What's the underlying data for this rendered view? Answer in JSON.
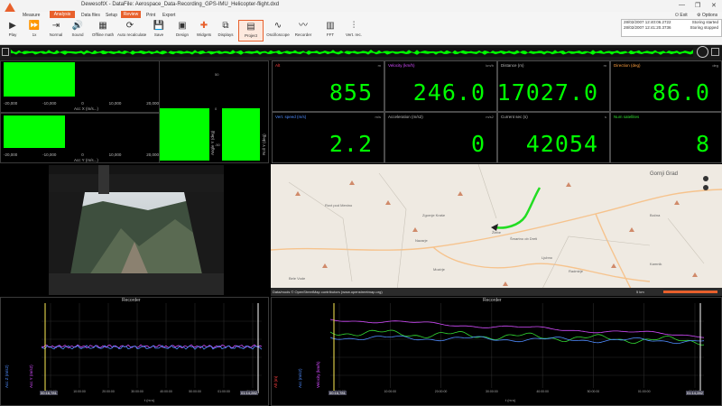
{
  "app": {
    "title": "DewesoftX - DataFile: Aerospace_Data-Recording_GPS-IMU_Helicopter-flight.dxd",
    "minimize": "—",
    "maximize": "❐",
    "close": "✕",
    "exit": "Exit",
    "options": "Options"
  },
  "menu": {
    "measure": "Measure",
    "analysis": "Analysis",
    "data_files": "Data files",
    "setup": "Setup",
    "review": "Review",
    "print": "Print",
    "export": "Export"
  },
  "toolbar": {
    "play": "Play",
    "step": "1x",
    "normal": "Normal",
    "sound": "Sound",
    "offline_math": "Offline math",
    "auto_recalculate": "Auto recalculate",
    "save": "Save",
    "design": "Design",
    "widgets": "Widgets",
    "displays": "Displays",
    "project": "Project",
    "oscilloscope": "Oscilloscope",
    "recorder": "Recorder",
    "fft": "FFT",
    "vert_rec": "Vert. rec."
  },
  "log": [
    {
      "time": "28/02/2007 12:40:06.2722",
      "msg": "Storing started"
    },
    {
      "time": "28/02/2007 12:41:20.3736",
      "msg": "Storing stopped"
    }
  ],
  "histograms": {
    "top": {
      "ticks": [
        "-20,000",
        "-10,000",
        "0",
        "10,000",
        "20,000"
      ],
      "axis": "Acc X (m/s...)",
      "value": 0.44
    },
    "bottom": {
      "ticks": [
        "-20,000",
        "-10,000",
        "0",
        "10,000",
        "20,000"
      ],
      "axis": "Acc Y (m/s...)",
      "value": 0.38
    }
  },
  "vbars": {
    "left_label": "Angle Y (deg)",
    "right_label": "Roll Y (deg)",
    "ticks_left": [
      "300",
      "50",
      "0",
      "-50"
    ],
    "ticks_right": [
      "300",
      "50",
      "0",
      "-50"
    ]
  },
  "digitals": [
    {
      "title": "Alt",
      "unit": "m",
      "value": "855",
      "color": "#ff4040"
    },
    {
      "title": "Velocity (km/h)",
      "unit": "km/h",
      "value": "246.0",
      "color": "#d44cff"
    },
    {
      "title": "Distance (m)",
      "unit": "m",
      "value": "17027.0",
      "color": "#bbbbbb"
    },
    {
      "title": "Direction (deg)",
      "unit": "deg",
      "value": "86.0",
      "color": "#ffa040"
    },
    {
      "title": "Vert. speed (m/s)",
      "unit": "m/s",
      "value": "2.2",
      "color": "#4f8cff"
    },
    {
      "title": "Acceleration (m/s2)",
      "unit": "m/s2",
      "value": "0",
      "color": "#bbbbbb"
    },
    {
      "title": "Current sec (s)",
      "unit": "s",
      "value": "42054",
      "color": "#bbbbbb"
    },
    {
      "title": "Num satellites",
      "unit": "",
      "value": "8",
      "color": "#33dd33"
    }
  ],
  "map": {
    "places": [
      "Gornji Grad",
      "Zgornje Kraše",
      "Žlebe",
      "Šmartno ob Dreti",
      "Rovt pod Menino",
      "Nazarje",
      "Bočna",
      "Ljubno",
      "Radmirje",
      "Mozirje",
      "Bele Vode",
      "Kamnik"
    ],
    "attribution": "Data/mods © OpenStreetMap contributors (www.openstreetmap.org)",
    "scale": "5 km",
    "trajectory_color": "#22dd22"
  },
  "recorders": {
    "left": {
      "title": "Recorder",
      "start": "00:16,781",
      "end": "01:14,282",
      "ticks": [
        "00:00:00",
        "10:00:00",
        "20:00:00",
        "30:00:00",
        "40:00:00",
        "50:00:00",
        "01:00:00",
        "01:10:00"
      ],
      "xlabel": "t (m:s)"
    },
    "right": {
      "title": "Recorder",
      "start": "00:16,781",
      "end": "01:14,282",
      "ticks": [
        "00:00:00",
        "10:00:00",
        "20:00:00",
        "30:00:00",
        "40:00:00",
        "50:00:00",
        "01:00:00",
        "01:10:00"
      ],
      "xlabel": "t (m:s)"
    }
  },
  "colors": {
    "accent": "#e8602c",
    "green": "#00ff00",
    "panel_border": "#3a3a3a"
  }
}
